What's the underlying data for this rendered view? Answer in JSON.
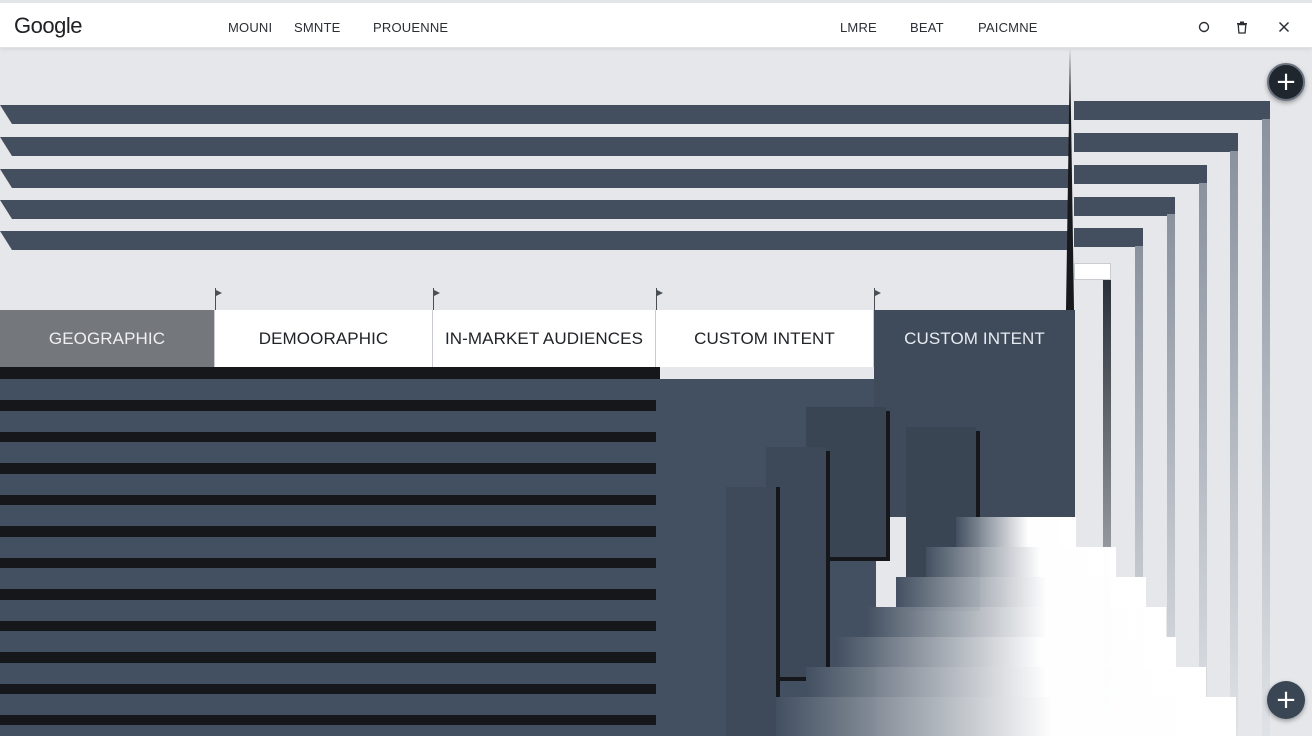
{
  "app": {
    "logo": "Google"
  },
  "nav": {
    "left": [
      "MOUNI",
      "SMNTE",
      "PROUENNE"
    ],
    "right": [
      "LMRE",
      "BEAT",
      "PAICMNE"
    ]
  },
  "toolbar_icons": [
    "circle-icon",
    "trash-icon",
    "close-icon"
  ],
  "tabs": [
    {
      "label": "GEOGRAPHIC"
    },
    {
      "label": "DEMOORAPHIC"
    },
    {
      "label": "IN-MARKET AUDIENCES"
    },
    {
      "label": "CUSTOM INTENT"
    },
    {
      "label": "CUSTOM INTENT"
    }
  ],
  "fabs": {
    "top_symbol": "+",
    "bottom_symbol": "+"
  },
  "colors": {
    "slate": "#434f5f",
    "active_tab": "#3f4b5b",
    "geo_tab": "#74777c",
    "background": "#e6e7ea"
  }
}
